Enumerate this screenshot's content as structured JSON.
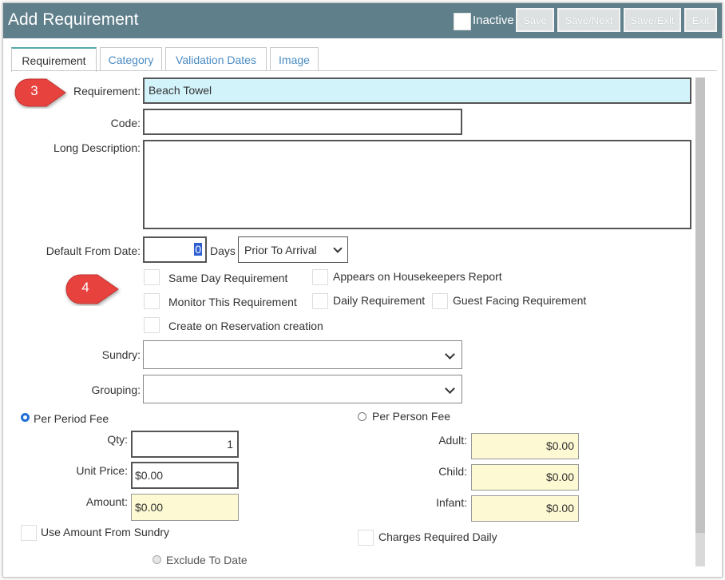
{
  "header": {
    "title": "Add Requirement",
    "inactive_label": "Inactive",
    "buttons": {
      "save": "Save",
      "save_next": "Save/Next",
      "save_exit": "Save/Exit",
      "exit": "Exit"
    }
  },
  "tabs": [
    "Requirement",
    "Category",
    "Validation Dates",
    "Image"
  ],
  "markers": [
    "3",
    "4"
  ],
  "form": {
    "requirement_label": "Requirement:",
    "requirement_value": "Beach Towel",
    "code_label": "Code:",
    "code_value": "",
    "long_description_label": "Long Description:",
    "long_description_value": "",
    "default_from_date_label": "Default From Date:",
    "default_from_date_value": "0",
    "days_label": "Days",
    "prior_option": "Prior To Arrival",
    "checkboxes": [
      "Same Day Requirement",
      "Appears on Housekeepers Report",
      "Monitor This Requirement",
      "Daily Requirement",
      "Guest Facing Requirement",
      "Create on Reservation creation"
    ],
    "sundry_label": "Sundry:",
    "sundry_value": "",
    "grouping_label": "Grouping:",
    "grouping_value": ""
  },
  "fees": {
    "per_period_label": "Per Period Fee",
    "per_person_label": "Per Person Fee",
    "qty_label": "Qty:",
    "qty_value": "1",
    "unit_price_label": "Unit Price:",
    "unit_price_value": "$0.00",
    "amount_label": "Amount:",
    "amount_value": "$0.00",
    "adult_label": "Adult:",
    "adult_value": "$0.00",
    "child_label": "Child:",
    "child_value": "$0.00",
    "infant_label": "Infant:",
    "infant_value": "$0.00",
    "use_amount_label": "Use Amount From Sundry",
    "charges_daily_label": "Charges Required Daily",
    "exclude_to_date_label": "Exclude To Date"
  },
  "colors": {
    "header_bg": "#5f7f8b",
    "highlight": "#d3f3fb",
    "readonly": "#fdf9d3",
    "marker": "#e8423f"
  }
}
